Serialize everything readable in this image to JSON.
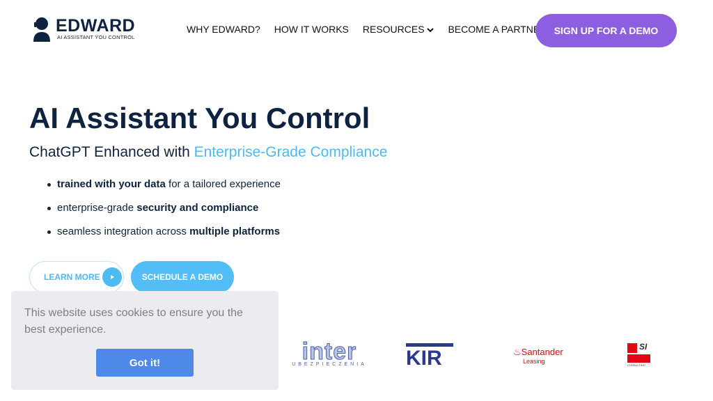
{
  "brand": {
    "name": "EDWARD",
    "tagline": "AI ASSISTANT YOU CONTROL"
  },
  "nav": {
    "items": [
      "WHY EDWARD?",
      "HOW IT WORKS",
      "RESOURCES",
      "BECOME A PARTNER"
    ],
    "signup": "SIGN UP FOR A DEMO"
  },
  "hero": {
    "title": "AI Assistant You Control",
    "subtitle_plain": "ChatGPT Enhanced with ",
    "subtitle_highlight": "Enterprise-Grade Compliance",
    "bullets": [
      {
        "bold": "trained with your data",
        "rest": " for a tailored experience"
      },
      {
        "pre": "enterprise-grade ",
        "bold": "security and compliance"
      },
      {
        "pre": "seamless integration across ",
        "bold": "multiple platforms"
      }
    ],
    "learn_more": "LEARN MORE",
    "schedule": "SCHEDULE A DEMO"
  },
  "cookie": {
    "text": "This website uses cookies to ensure you the best experience.",
    "button": "Got it!"
  },
  "partners": [
    {
      "name": "inter",
      "sub": "UBEZPIECZENIA"
    },
    {
      "name": "KIR"
    },
    {
      "name": "Santander",
      "sub": "Leasing"
    },
    {
      "name": "SI",
      "sub": "CONSULTING"
    }
  ],
  "colors": {
    "navy": "#0d2340",
    "purple": "#8c5ee0",
    "sky": "#4fb9f2",
    "santander": "#e30613"
  }
}
